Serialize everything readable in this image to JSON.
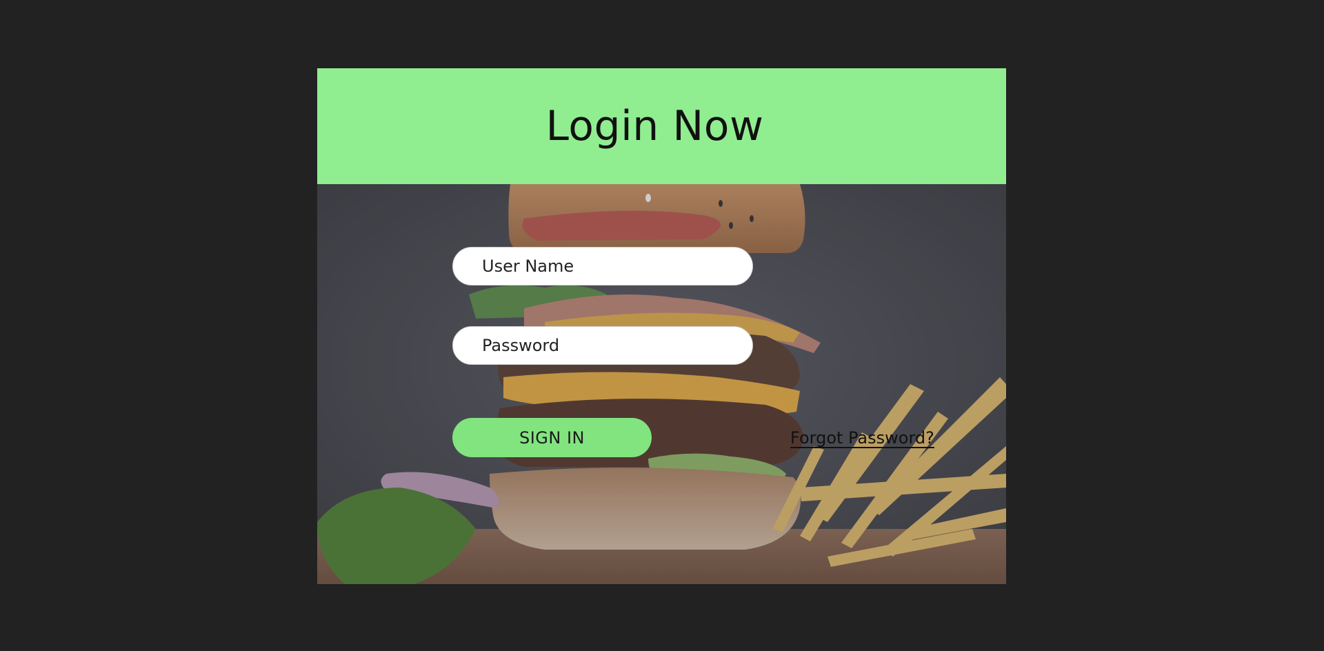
{
  "header": {
    "title": "Login Now"
  },
  "form": {
    "username_placeholder": "User Name",
    "password_placeholder": "Password",
    "signin_label": "SIGN IN",
    "forgot_label": "Forgot Password?"
  },
  "colors": {
    "header_bg": "#90ee90",
    "button_bg": "#82e47f",
    "page_bg": "#222222"
  }
}
